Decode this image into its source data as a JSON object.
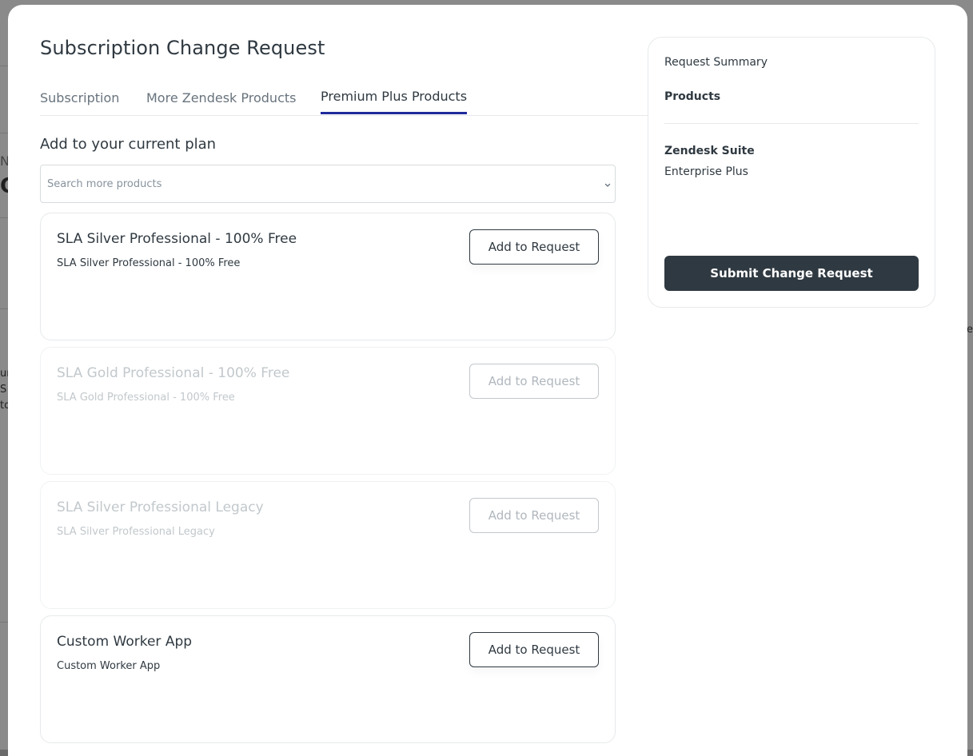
{
  "background": {
    "fragments": [
      "N",
      "C",
      "ur",
      "S",
      "to",
      "e"
    ]
  },
  "modal": {
    "title": "Subscription Change Request",
    "tabs": [
      {
        "label": "Subscription",
        "active": false
      },
      {
        "label": "More Zendesk Products",
        "active": false
      },
      {
        "label": "Premium Plus Products",
        "active": true
      }
    ],
    "section_title": "Add to your current plan",
    "search": {
      "placeholder": "Search more products",
      "value": ""
    },
    "products": [
      {
        "name": "SLA Silver Professional - 100% Free",
        "description": "SLA Silver Professional - 100% Free",
        "button": "Add to Request",
        "enabled": true
      },
      {
        "name": "SLA Gold Professional - 100% Free",
        "description": "SLA Gold Professional - 100% Free",
        "button": "Add to Request",
        "enabled": false
      },
      {
        "name": "SLA Silver Professional Legacy",
        "description": "SLA Silver Professional Legacy",
        "button": "Add to Request",
        "enabled": false
      },
      {
        "name": "Custom Worker App",
        "description": "Custom Worker App",
        "button": "Add to Request",
        "enabled": true
      }
    ]
  },
  "summary": {
    "label": "Request Summary",
    "products_heading": "Products",
    "items": [
      {
        "name": "Zendesk Suite",
        "plan": "Enterprise Plus"
      }
    ],
    "submit_label": "Submit Change Request"
  },
  "colors": {
    "active_tab_underline": "#1f2a9b",
    "primary_button": "#2f3941",
    "text": "#2f3941",
    "muted_text": "#68737d",
    "disabled_text": "#c2c8cc"
  }
}
